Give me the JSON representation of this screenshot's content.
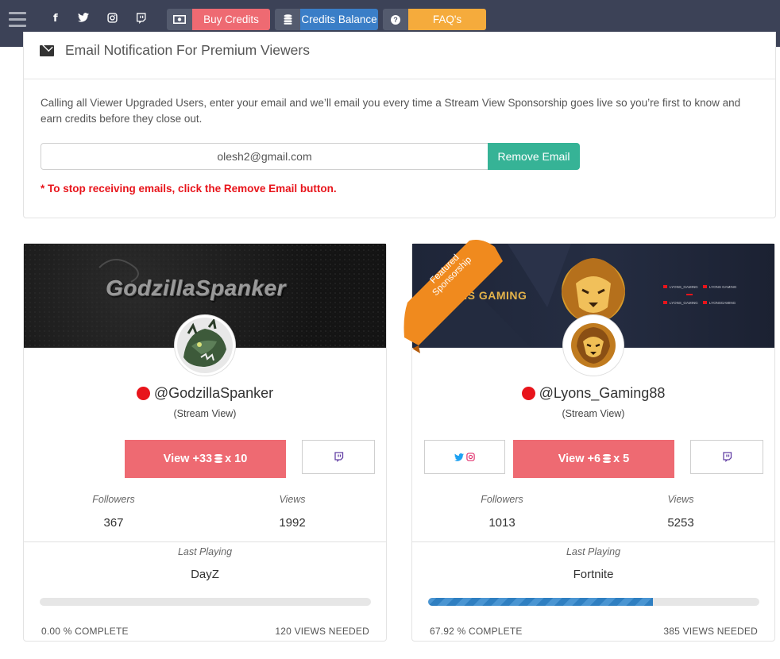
{
  "nav": {
    "buy_credits": "Buy Credits",
    "credits_balance": "Credits Balance",
    "faqs": "FAQ's",
    "colors": {
      "bar": "#3c4257",
      "buy": "#ee6a72",
      "balance": "#3a7ec7",
      "faq": "#f5ab3c"
    },
    "social_icons": [
      "facebook-icon",
      "twitter-icon",
      "instagram-icon",
      "twitch-icon"
    ]
  },
  "email_section": {
    "title": "Email Notification For Premium Viewers",
    "description": "Calling all Viewer Upgraded Users, enter your email and we’ll email you every time a Stream View Sponsorship goes live so you’re first to know and earn credits before they close out.",
    "email_value": "olesh2@gmail.com",
    "remove_button": "Remove Email",
    "note": "* To stop receiving emails, click the Remove Email button."
  },
  "cards": [
    {
      "banner_text": "GodzillaSpanker",
      "name": "@GodzillaSpanker",
      "type": "(Stream View)",
      "view_button_prefix": "View +33",
      "view_button_suffix": "x 10",
      "followers_label": "Followers",
      "followers": "367",
      "views_label": "Views",
      "views": "1992",
      "last_playing_label": "Last Playing",
      "game": "DayZ",
      "progress": 0.0,
      "complete_text": "0.00 % COMPLETE",
      "needed_text": "120 VIEWS NEEDED"
    },
    {
      "banner_text": "LYONS GAMING",
      "ribbon_text": "Featured Sponsorship",
      "name": "@Lyons_Gaming88",
      "type": "(Stream View)",
      "view_button_prefix": "View +6",
      "view_button_suffix": "x 5",
      "followers_label": "Followers",
      "followers": "1013",
      "views_label": "Views",
      "views": "5253",
      "last_playing_label": "Last Playing",
      "game": "Fortnite",
      "progress": 0.6792,
      "complete_text": "67.92 % COMPLETE",
      "needed_text": "385 VIEWS NEEDED"
    }
  ]
}
